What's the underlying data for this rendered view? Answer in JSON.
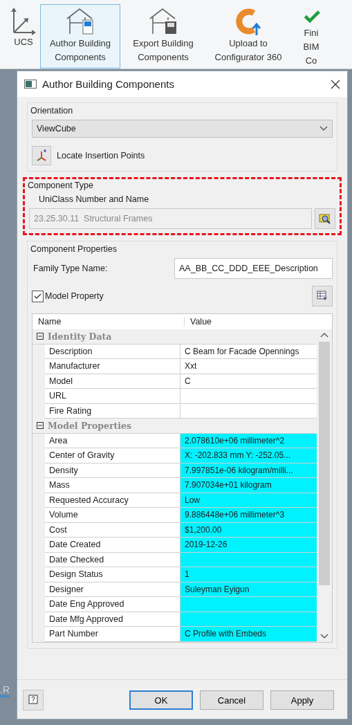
{
  "ribbon": {
    "tools": [
      {
        "kind": "ucs",
        "label": "UCS",
        "selected": false
      },
      {
        "kind": "author",
        "label": "Author Building Components",
        "selected": true
      },
      {
        "kind": "export",
        "label": "Export Building Components",
        "selected": false
      },
      {
        "kind": "upload",
        "label": "Upload to Configurator 360",
        "selected": false
      },
      {
        "kind": "finish",
        "label": "Fini BIM Co",
        "selected": false
      }
    ],
    "behind_text": ".R"
  },
  "dialog": {
    "title": "Author Building Components",
    "orientation": {
      "label": "Orientation",
      "value": "ViewCube",
      "locate_button": "Locate Insertion Points"
    },
    "component_type": {
      "label": "Component Type",
      "highlighted": true,
      "field_label": "UniClass Number and Name",
      "value": "23.25.30.11  Structural Frames"
    },
    "component_properties": {
      "label": "Component Properties",
      "family_label": "Family Type Name:",
      "family_value": "AA_BB_CC_DDD_EEE_Description",
      "model_property": {
        "label": "Model Property",
        "checked": true
      },
      "table": {
        "columns": [
          "Name",
          "Value"
        ],
        "groups": [
          {
            "label": "Identity Data",
            "expanded": true,
            "rows": [
              {
                "name": "Description",
                "value": "C Beam for Facade Opennings",
                "highlighted": false
              },
              {
                "name": "Manufacturer",
                "value": "Xxt",
                "highlighted": false
              },
              {
                "name": "Model",
                "value": "C",
                "highlighted": false
              },
              {
                "name": "URL",
                "highlighted": false
              },
              {
                "name": "Fire Rating",
                "highlighted": false
              }
            ]
          },
          {
            "label": "Model Properties",
            "expanded": true,
            "rows": [
              {
                "name": "Area",
                "value": "2.078610e+06 millimeter^2",
                "highlighted": true
              },
              {
                "name": "Center of Gravity",
                "value": "X: -202.833 mm Y: -252.05...",
                "highlighted": true
              },
              {
                "name": "Density",
                "value": "7.997851e-06 kilogram/milli...",
                "highlighted": true
              },
              {
                "name": "Mass",
                "value": "7.907034e+01 kilogram",
                "highlighted": true
              },
              {
                "name": "Requested Accuracy",
                "value": "Low",
                "highlighted": true
              },
              {
                "name": "Volume",
                "value": "9.886448e+06 millimeter^3",
                "highlighted": true
              },
              {
                "name": "Cost",
                "value": "$1,200.00",
                "highlighted": true
              },
              {
                "name": "Date Created",
                "value": "2019-12-26",
                "highlighted": true
              },
              {
                "name": "Date Checked",
                "highlighted": true
              },
              {
                "name": "Design Status",
                "value": "1",
                "highlighted": true
              },
              {
                "name": "Designer",
                "value": "Suleyman Eyigun",
                "highlighted": true
              },
              {
                "name": "Date Eng Approved",
                "highlighted": true
              },
              {
                "name": "Date Mfg Approved",
                "highlighted": true
              },
              {
                "name": "Part Number",
                "value": "C Profile with Embeds",
                "highlighted": true
              }
            ]
          }
        ]
      }
    },
    "buttons": [
      {
        "label": "OK",
        "default": true
      },
      {
        "label": "Cancel",
        "default": false
      },
      {
        "label": "Apply",
        "default": false
      }
    ]
  }
}
